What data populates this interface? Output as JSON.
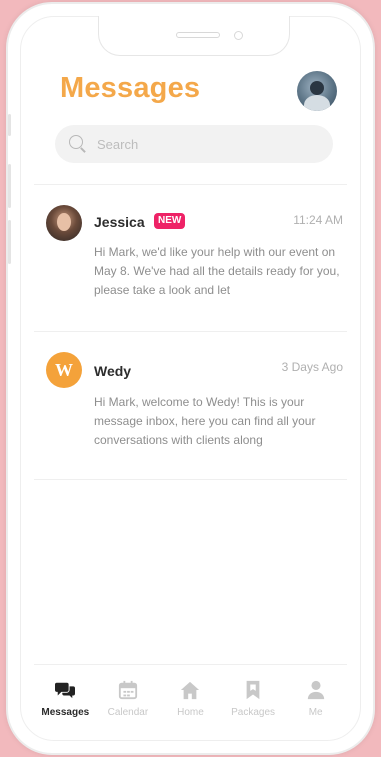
{
  "header": {
    "title": "Messages"
  },
  "search": {
    "placeholder": "Search"
  },
  "messages": [
    {
      "name": "Jessica",
      "badge": "NEW",
      "time": "11:24 AM",
      "preview": "Hi Mark, we'd like your help with our event on May 8. We've had all the details ready for you, please take a look and let"
    },
    {
      "name": "Wedy",
      "avatar_letter": "W",
      "time": "3 Days Ago",
      "preview": "Hi Mark, welcome to Wedy! This is your message inbox, here you can find all your conversations with clients along"
    }
  ],
  "tabs": [
    {
      "label": "Messages",
      "icon": "chat-icon",
      "active": true
    },
    {
      "label": "Calendar",
      "icon": "calendar-icon",
      "active": false
    },
    {
      "label": "Home",
      "icon": "home-icon",
      "active": false
    },
    {
      "label": "Packages",
      "icon": "bookmark-icon",
      "active": false
    },
    {
      "label": "Me",
      "icon": "person-icon",
      "active": false
    }
  ],
  "colors": {
    "accent": "#f4a84a",
    "badge": "#ee2266",
    "background": "#f2b9bd"
  }
}
